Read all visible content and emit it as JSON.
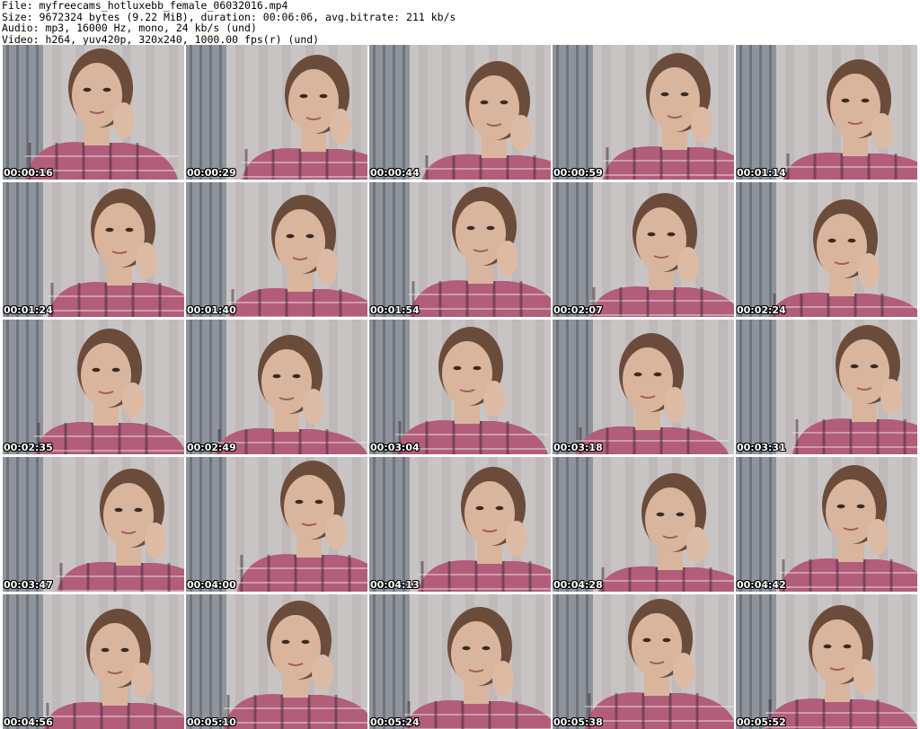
{
  "header": {
    "file": "File: myfreecams_hotluxebb_female_06032016.mp4",
    "size": "Size: 9672324 bytes (9.22 MiB), duration: 00:06:06, avg.bitrate: 211 kb/s",
    "audio": "Audio: mp3, 16000 Hz, mono, 24 kb/s (und)",
    "video": "Video: h264, yuv420p, 320x240, 1000.00 fps(r) (und)"
  },
  "frames": [
    {
      "timestamp": "00:00:16"
    },
    {
      "timestamp": "00:00:29"
    },
    {
      "timestamp": "00:00:44"
    },
    {
      "timestamp": "00:00:59"
    },
    {
      "timestamp": "00:01:14"
    },
    {
      "timestamp": "00:01:24"
    },
    {
      "timestamp": "00:01:40"
    },
    {
      "timestamp": "00:01:54"
    },
    {
      "timestamp": "00:02:07"
    },
    {
      "timestamp": "00:02:24"
    },
    {
      "timestamp": "00:02:35"
    },
    {
      "timestamp": "00:02:49"
    },
    {
      "timestamp": "00:03:04"
    },
    {
      "timestamp": "00:03:18"
    },
    {
      "timestamp": "00:03:31"
    },
    {
      "timestamp": "00:03:47"
    },
    {
      "timestamp": "00:04:00"
    },
    {
      "timestamp": "00:04:13"
    },
    {
      "timestamp": "00:04:28"
    },
    {
      "timestamp": "00:04:42"
    },
    {
      "timestamp": "00:04:56"
    },
    {
      "timestamp": "00:05:10"
    },
    {
      "timestamp": "00:05:24"
    },
    {
      "timestamp": "00:05:38"
    },
    {
      "timestamp": "00:05:52"
    }
  ],
  "colors": {
    "background": "#ffffff",
    "curtain": "#c9c4c4",
    "blinds": "#8f949c",
    "skin": "#d9b59e",
    "hair": "#6b4c3a",
    "shirt": "#b25d7a",
    "timestamp_text": "#ffffff",
    "timestamp_outline": "#000000"
  }
}
